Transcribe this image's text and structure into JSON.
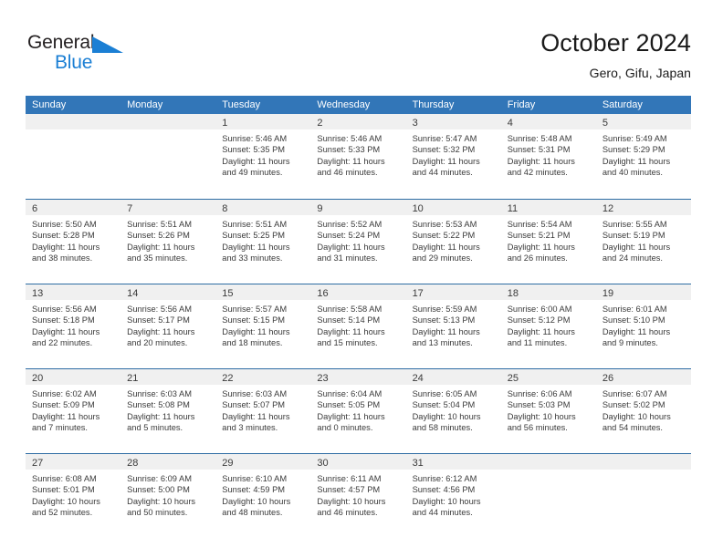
{
  "brand": {
    "name_part1": "General",
    "name_part2": "Blue",
    "triangle_icon": "blue-triangle-logo-mark",
    "color_dark": "#231f20",
    "color_blue": "#1b7fd4"
  },
  "header": {
    "title": "October 2024",
    "subtitle": "Gero, Gifu, Japan"
  },
  "theme": {
    "header_blue": "#3276b8",
    "row_divider_blue": "#2e6da4",
    "day_band_grey": "#f0f0f0",
    "text": "#3a3a3a"
  },
  "weekdays": [
    "Sunday",
    "Monday",
    "Tuesday",
    "Wednesday",
    "Thursday",
    "Friday",
    "Saturday"
  ],
  "weeks": [
    [
      {
        "day": "",
        "empty": true,
        "sunrise": "",
        "sunset": "",
        "daylight_l1": "",
        "daylight_l2": ""
      },
      {
        "day": "",
        "empty": true,
        "sunrise": "",
        "sunset": "",
        "daylight_l1": "",
        "daylight_l2": ""
      },
      {
        "day": "1",
        "sunrise": "Sunrise: 5:46 AM",
        "sunset": "Sunset: 5:35 PM",
        "daylight_l1": "Daylight: 11 hours",
        "daylight_l2": "and 49 minutes."
      },
      {
        "day": "2",
        "sunrise": "Sunrise: 5:46 AM",
        "sunset": "Sunset: 5:33 PM",
        "daylight_l1": "Daylight: 11 hours",
        "daylight_l2": "and 46 minutes."
      },
      {
        "day": "3",
        "sunrise": "Sunrise: 5:47 AM",
        "sunset": "Sunset: 5:32 PM",
        "daylight_l1": "Daylight: 11 hours",
        "daylight_l2": "and 44 minutes."
      },
      {
        "day": "4",
        "sunrise": "Sunrise: 5:48 AM",
        "sunset": "Sunset: 5:31 PM",
        "daylight_l1": "Daylight: 11 hours",
        "daylight_l2": "and 42 minutes."
      },
      {
        "day": "5",
        "sunrise": "Sunrise: 5:49 AM",
        "sunset": "Sunset: 5:29 PM",
        "daylight_l1": "Daylight: 11 hours",
        "daylight_l2": "and 40 minutes."
      }
    ],
    [
      {
        "day": "6",
        "sunrise": "Sunrise: 5:50 AM",
        "sunset": "Sunset: 5:28 PM",
        "daylight_l1": "Daylight: 11 hours",
        "daylight_l2": "and 38 minutes."
      },
      {
        "day": "7",
        "sunrise": "Sunrise: 5:51 AM",
        "sunset": "Sunset: 5:26 PM",
        "daylight_l1": "Daylight: 11 hours",
        "daylight_l2": "and 35 minutes."
      },
      {
        "day": "8",
        "sunrise": "Sunrise: 5:51 AM",
        "sunset": "Sunset: 5:25 PM",
        "daylight_l1": "Daylight: 11 hours",
        "daylight_l2": "and 33 minutes."
      },
      {
        "day": "9",
        "sunrise": "Sunrise: 5:52 AM",
        "sunset": "Sunset: 5:24 PM",
        "daylight_l1": "Daylight: 11 hours",
        "daylight_l2": "and 31 minutes."
      },
      {
        "day": "10",
        "sunrise": "Sunrise: 5:53 AM",
        "sunset": "Sunset: 5:22 PM",
        "daylight_l1": "Daylight: 11 hours",
        "daylight_l2": "and 29 minutes."
      },
      {
        "day": "11",
        "sunrise": "Sunrise: 5:54 AM",
        "sunset": "Sunset: 5:21 PM",
        "daylight_l1": "Daylight: 11 hours",
        "daylight_l2": "and 26 minutes."
      },
      {
        "day": "12",
        "sunrise": "Sunrise: 5:55 AM",
        "sunset": "Sunset: 5:19 PM",
        "daylight_l1": "Daylight: 11 hours",
        "daylight_l2": "and 24 minutes."
      }
    ],
    [
      {
        "day": "13",
        "sunrise": "Sunrise: 5:56 AM",
        "sunset": "Sunset: 5:18 PM",
        "daylight_l1": "Daylight: 11 hours",
        "daylight_l2": "and 22 minutes."
      },
      {
        "day": "14",
        "sunrise": "Sunrise: 5:56 AM",
        "sunset": "Sunset: 5:17 PM",
        "daylight_l1": "Daylight: 11 hours",
        "daylight_l2": "and 20 minutes."
      },
      {
        "day": "15",
        "sunrise": "Sunrise: 5:57 AM",
        "sunset": "Sunset: 5:15 PM",
        "daylight_l1": "Daylight: 11 hours",
        "daylight_l2": "and 18 minutes."
      },
      {
        "day": "16",
        "sunrise": "Sunrise: 5:58 AM",
        "sunset": "Sunset: 5:14 PM",
        "daylight_l1": "Daylight: 11 hours",
        "daylight_l2": "and 15 minutes."
      },
      {
        "day": "17",
        "sunrise": "Sunrise: 5:59 AM",
        "sunset": "Sunset: 5:13 PM",
        "daylight_l1": "Daylight: 11 hours",
        "daylight_l2": "and 13 minutes."
      },
      {
        "day": "18",
        "sunrise": "Sunrise: 6:00 AM",
        "sunset": "Sunset: 5:12 PM",
        "daylight_l1": "Daylight: 11 hours",
        "daylight_l2": "and 11 minutes."
      },
      {
        "day": "19",
        "sunrise": "Sunrise: 6:01 AM",
        "sunset": "Sunset: 5:10 PM",
        "daylight_l1": "Daylight: 11 hours",
        "daylight_l2": "and 9 minutes."
      }
    ],
    [
      {
        "day": "20",
        "sunrise": "Sunrise: 6:02 AM",
        "sunset": "Sunset: 5:09 PM",
        "daylight_l1": "Daylight: 11 hours",
        "daylight_l2": "and 7 minutes."
      },
      {
        "day": "21",
        "sunrise": "Sunrise: 6:03 AM",
        "sunset": "Sunset: 5:08 PM",
        "daylight_l1": "Daylight: 11 hours",
        "daylight_l2": "and 5 minutes."
      },
      {
        "day": "22",
        "sunrise": "Sunrise: 6:03 AM",
        "sunset": "Sunset: 5:07 PM",
        "daylight_l1": "Daylight: 11 hours",
        "daylight_l2": "and 3 minutes."
      },
      {
        "day": "23",
        "sunrise": "Sunrise: 6:04 AM",
        "sunset": "Sunset: 5:05 PM",
        "daylight_l1": "Daylight: 11 hours",
        "daylight_l2": "and 0 minutes."
      },
      {
        "day": "24",
        "sunrise": "Sunrise: 6:05 AM",
        "sunset": "Sunset: 5:04 PM",
        "daylight_l1": "Daylight: 10 hours",
        "daylight_l2": "and 58 minutes."
      },
      {
        "day": "25",
        "sunrise": "Sunrise: 6:06 AM",
        "sunset": "Sunset: 5:03 PM",
        "daylight_l1": "Daylight: 10 hours",
        "daylight_l2": "and 56 minutes."
      },
      {
        "day": "26",
        "sunrise": "Sunrise: 6:07 AM",
        "sunset": "Sunset: 5:02 PM",
        "daylight_l1": "Daylight: 10 hours",
        "daylight_l2": "and 54 minutes."
      }
    ],
    [
      {
        "day": "27",
        "sunrise": "Sunrise: 6:08 AM",
        "sunset": "Sunset: 5:01 PM",
        "daylight_l1": "Daylight: 10 hours",
        "daylight_l2": "and 52 minutes."
      },
      {
        "day": "28",
        "sunrise": "Sunrise: 6:09 AM",
        "sunset": "Sunset: 5:00 PM",
        "daylight_l1": "Daylight: 10 hours",
        "daylight_l2": "and 50 minutes."
      },
      {
        "day": "29",
        "sunrise": "Sunrise: 6:10 AM",
        "sunset": "Sunset: 4:59 PM",
        "daylight_l1": "Daylight: 10 hours",
        "daylight_l2": "and 48 minutes."
      },
      {
        "day": "30",
        "sunrise": "Sunrise: 6:11 AM",
        "sunset": "Sunset: 4:57 PM",
        "daylight_l1": "Daylight: 10 hours",
        "daylight_l2": "and 46 minutes."
      },
      {
        "day": "31",
        "sunrise": "Sunrise: 6:12 AM",
        "sunset": "Sunset: 4:56 PM",
        "daylight_l1": "Daylight: 10 hours",
        "daylight_l2": "and 44 minutes."
      },
      {
        "day": "",
        "empty": true,
        "sunrise": "",
        "sunset": "",
        "daylight_l1": "",
        "daylight_l2": ""
      },
      {
        "day": "",
        "empty": true,
        "sunrise": "",
        "sunset": "",
        "daylight_l1": "",
        "daylight_l2": ""
      }
    ]
  ]
}
